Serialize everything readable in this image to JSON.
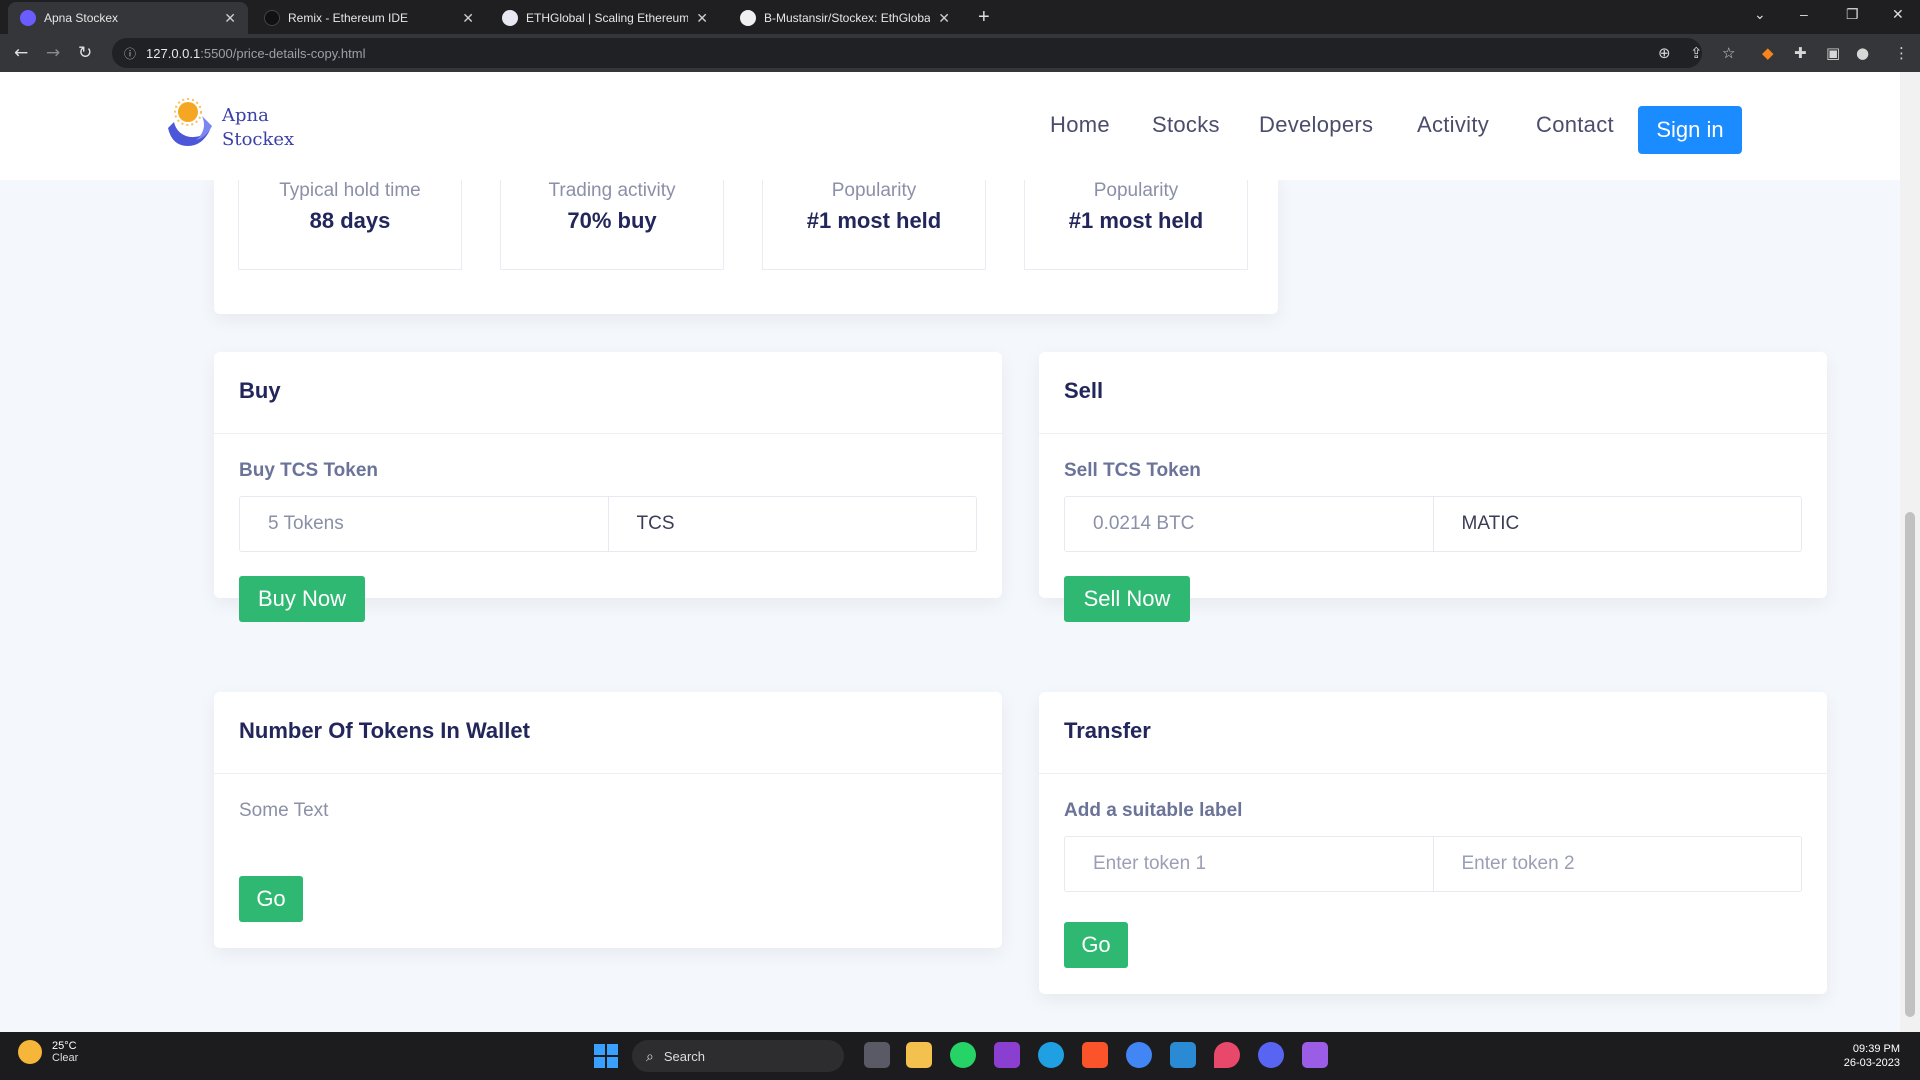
{
  "browser": {
    "tabs": [
      {
        "title": "Apna Stockex",
        "active": true
      },
      {
        "title": "Remix - Ethereum IDE",
        "active": false
      },
      {
        "title": "ETHGlobal | Scaling Ethereum 20",
        "active": false
      },
      {
        "title": "B-Mustansir/Stockex: EthGlobal -",
        "active": false
      }
    ],
    "url_host": "127.0.0.1",
    "url_path": ":5500/price-details-copy.html"
  },
  "site": {
    "logo_line1": "Apna",
    "logo_line2": "Stockex",
    "nav": [
      "Home",
      "Stocks",
      "Developers",
      "Activity",
      "Contact"
    ],
    "signin_label": "Sign in"
  },
  "stats": [
    {
      "label": "Typical hold time",
      "value": "88 days"
    },
    {
      "label": "Trading activity",
      "value": "70% buy"
    },
    {
      "label": "Popularity",
      "value": "#1 most held"
    },
    {
      "label": "Popularity",
      "value": "#1 most held"
    }
  ],
  "buy": {
    "title": "Buy",
    "subtitle": "Buy TCS Token",
    "amount_value": "5 Tokens",
    "token_value": "TCS",
    "button": "Buy Now"
  },
  "sell": {
    "title": "Sell",
    "subtitle": "Sell TCS Token",
    "amount_value": "0.0214 BTC",
    "token_value": "MATIC",
    "button": "Sell Now"
  },
  "wallet": {
    "title": "Number Of Tokens In Wallet",
    "text": "Some Text",
    "button": "Go"
  },
  "transfer": {
    "title": "Transfer",
    "subtitle": "Add a suitable label",
    "placeholder_1": "Enter token 1",
    "placeholder_2": "Enter token 2",
    "button": "Go"
  },
  "taskbar": {
    "temperature": "25°C",
    "condition": "Clear",
    "search_label": "Search",
    "time": "09:39 PM",
    "date": "26-03-2023"
  },
  "colors": {
    "primary_blue": "#1a8cff",
    "green": "#2eb872",
    "heading": "#22265a"
  }
}
